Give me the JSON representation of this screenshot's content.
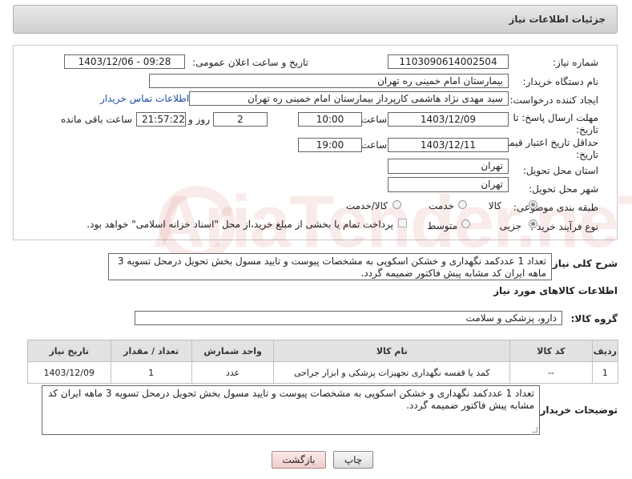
{
  "header": {
    "title": "جزئیات اطلاعات نیاز"
  },
  "form": {
    "need_number": {
      "label": "شماره نیاز:",
      "value": "1103090614002504"
    },
    "announce_datetime": {
      "label": "تاریخ و ساعت اعلان عمومی:",
      "value": "1403/12/06 - 09:28"
    },
    "buyer_org": {
      "label": "نام دستگاه خریدار:",
      "value": "بیمارستان امام خمینی ره  تهران"
    },
    "requester": {
      "label": "ایجاد کننده درخواست:",
      "value": "سید مهدی  نژاد هاشمی  کارپرداز بیمارستان امام خمینی ره  تهران",
      "contact_link": "اطلاعات تماس خریدار"
    },
    "reply_deadline": {
      "label_line1": "مهلت ارسال پاسخ: تا",
      "label_line2": "تاریخ:",
      "date": "1403/12/09",
      "time_label": "ساعت",
      "time": "10:00",
      "days": "2",
      "days_label": "روز و",
      "remaining": "21:57:22",
      "remaining_label": "ساعت باقی مانده"
    },
    "price_validity": {
      "label_line1": "حداقل تاریخ اعتبار قیمت: تا",
      "label_line2": "تاریخ:",
      "date": "1403/12/11",
      "time_label": "ساعت",
      "time": "19:00"
    },
    "delivery_province": {
      "label": "استان محل تحویل:",
      "value": "تهران"
    },
    "delivery_city": {
      "label": "شهر محل تحویل:",
      "value": "تهران"
    },
    "category": {
      "label": "طبقه بندی موضوعی:",
      "options": [
        "کالا",
        "خدمت",
        "کالا/خدمت"
      ],
      "selected": "کالا"
    },
    "purchase_type": {
      "label": "نوع فرآیند خرید :",
      "options": [
        "جزیی",
        "متوسط"
      ],
      "selected": "جزیی",
      "payment_note": "پرداخت تمام یا بخشی از مبلغ خرید،از محل \"اسناد خزانه اسلامی\" خواهد بود."
    }
  },
  "description": {
    "label": "شرح کلی نیاز:",
    "text": "تعداد 1 عددکمد نگهداری و خشکن اسکوپی به مشخصات پیوست و تایید مسول بخش  تحویل درمحل تسویه 3 ماهه ایران کد مشابه پیش فاکتور ضمیمه گردد."
  },
  "goods_info": {
    "title": "اطلاعات کالاهای مورد نیاز",
    "group_label": "گروه کالا:",
    "group_value": "دارو، پزشکی و سلامت"
  },
  "table": {
    "headers": [
      "ردیف",
      "کد کالا",
      "نام کالا",
      "واحد شمارش",
      "تعداد / مقدار",
      "تاریخ نیاز"
    ],
    "rows": [
      [
        "1",
        "--",
        "کمد یا قفسه نگهداری تجهیزات پزشکی و ابزار جراحی",
        "عدد",
        "1",
        "1403/12/09"
      ]
    ]
  },
  "buyer_notes": {
    "label": "توضیحات خریدار:",
    "text": "تعداد 1 عددکمد نگهداری و خشکن اسکوپی به مشخصات پیوست و تایید مسول بخش  تحویل درمحل تسویه 3 ماهه ایران کد مشابه پیش فاکتور ضمیمه گردد."
  },
  "buttons": {
    "print": "چاپ",
    "back": "بازگشت"
  }
}
